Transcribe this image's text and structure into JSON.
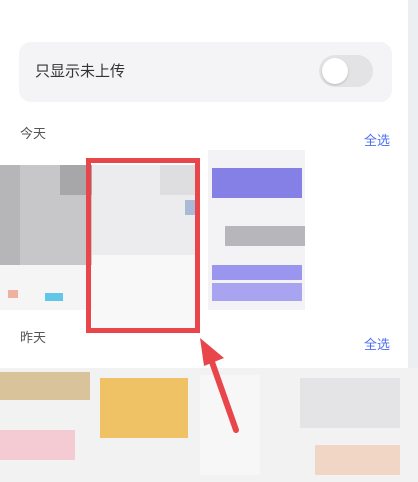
{
  "filter": {
    "only_unuploaded_label": "只显示未上传",
    "toggle_on": false
  },
  "sections": [
    {
      "title": "今天",
      "select_all": "全选"
    },
    {
      "title": "昨天",
      "select_all": "全选"
    }
  ],
  "colors": {
    "accent": "#4e6ef2",
    "highlight": "#e8464b"
  }
}
